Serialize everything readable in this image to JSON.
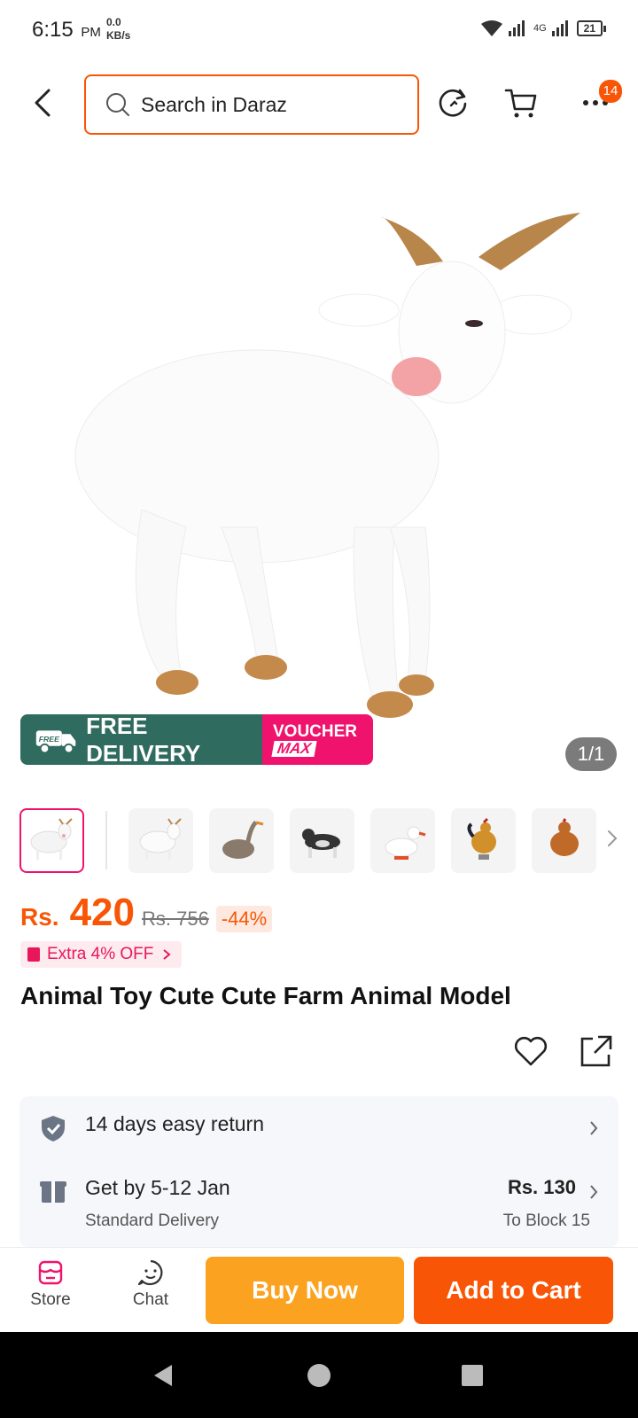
{
  "status_bar": {
    "time": "6:15",
    "ampm": "PM",
    "net_speed_value": "0.0",
    "net_speed_unit": "KB/s",
    "network_label": "4G",
    "battery": "21"
  },
  "header": {
    "search_placeholder": "Search in Daraz",
    "more_badge": "14"
  },
  "product": {
    "image_counter": "1/1",
    "promo_free_badge": "FREE",
    "promo_free_delivery": "FREE DELIVERY",
    "promo_voucher_line1": "VOUCHER",
    "promo_voucher_line2": "MAX",
    "price_currency": "Rs.",
    "price_value": "420",
    "price_old": "Rs. 756",
    "discount": "-44%",
    "extra_off": "Extra 4% OFF",
    "title": "Animal Toy Cute Cute Farm Animal Model"
  },
  "thumbnails": [
    {
      "name": "goat"
    },
    {
      "name": "goat"
    },
    {
      "name": "goose"
    },
    {
      "name": "dog"
    },
    {
      "name": "duck"
    },
    {
      "name": "rooster"
    },
    {
      "name": "hen"
    }
  ],
  "delivery": {
    "return_text": "14 days easy return",
    "get_by": "Get by 5-12 Jan",
    "delivery_type": "Standard Delivery",
    "delivery_price": "Rs. 130",
    "delivery_to": "To Block 15"
  },
  "bottom_bar": {
    "store_label": "Store",
    "chat_label": "Chat",
    "buy_now": "Buy Now",
    "add_to_cart": "Add to Cart"
  },
  "colors": {
    "brand_orange": "#f85606",
    "buy_yellow": "#fba320",
    "promo_green": "#2f6b5e",
    "promo_pink": "#f0136d"
  }
}
